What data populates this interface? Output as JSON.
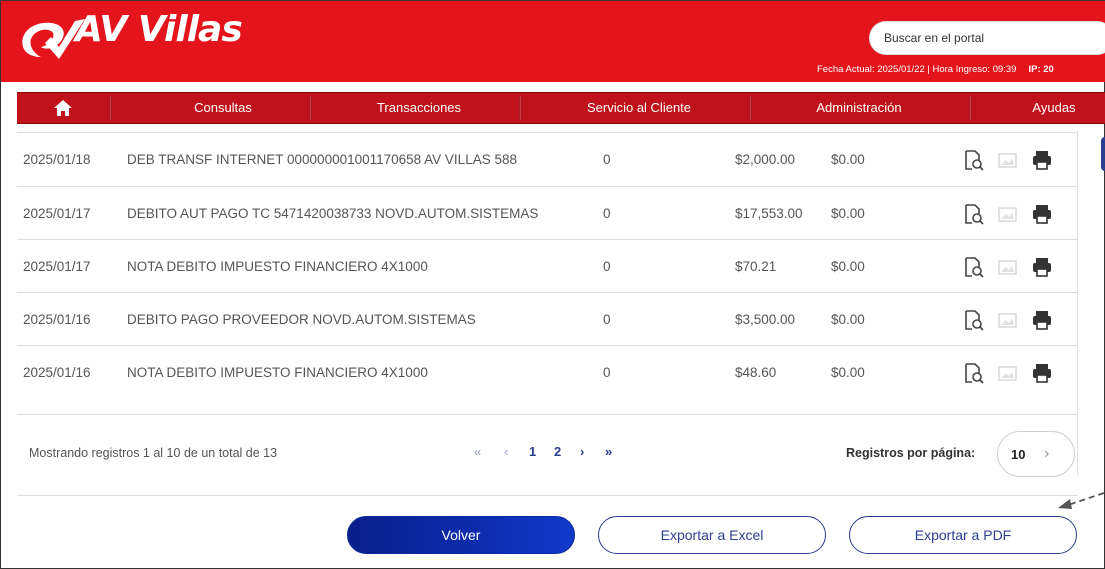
{
  "header": {
    "brand": "AV Villas",
    "search_placeholder": "Buscar en el portal",
    "meta_text": "Fecha Actual: 2025/01/22 | Hora Ingreso: 09:39",
    "ip_label": "IP: 20",
    "brand_color": "#e3141b"
  },
  "nav": {
    "items": [
      "Consultas",
      "Transacciones",
      "Servicio al Cliente",
      "Administración",
      "Ayudas"
    ]
  },
  "transactions": [
    {
      "date": "2025/01/18",
      "description": "DEB TRANSF INTERNET 000000001001170658 AV VILLAS 588",
      "ref": "0",
      "debit": "$2,000.00",
      "credit": "$0.00"
    },
    {
      "date": "2025/01/17",
      "description": "DEBITO AUT PAGO TC 5471420038733 NOVD.AUTOM.SISTEMAS",
      "ref": "0",
      "debit": "$17,553.00",
      "credit": "$0.00"
    },
    {
      "date": "2025/01/17",
      "description": "NOTA DEBITO IMPUESTO FINANCIERO 4X1000",
      "ref": "0",
      "debit": "$70.21",
      "credit": "$0.00"
    },
    {
      "date": "2025/01/16",
      "description": "DEBITO PAGO PROVEEDOR NOVD.AUTOM.SISTEMAS",
      "ref": "0",
      "debit": "$3,500.00",
      "credit": "$0.00"
    },
    {
      "date": "2025/01/16",
      "description": "NOTA DEBITO IMPUESTO FINANCIERO 4X1000",
      "ref": "0",
      "debit": "$48.60",
      "credit": "$0.00"
    }
  ],
  "row_icons": [
    "document-search-icon",
    "image-icon",
    "print-icon"
  ],
  "pagination": {
    "info": "Mostrando registros 1 al 10 de un total de 13",
    "first": "«",
    "prev": "‹",
    "pages": [
      "1",
      "2"
    ],
    "next": "›",
    "last": "»",
    "per_page_label": "Registros por página:",
    "per_page_value": "10"
  },
  "buttons": {
    "back": "Volver",
    "excel": "Exportar a Excel",
    "pdf": "Exportar a PDF"
  }
}
